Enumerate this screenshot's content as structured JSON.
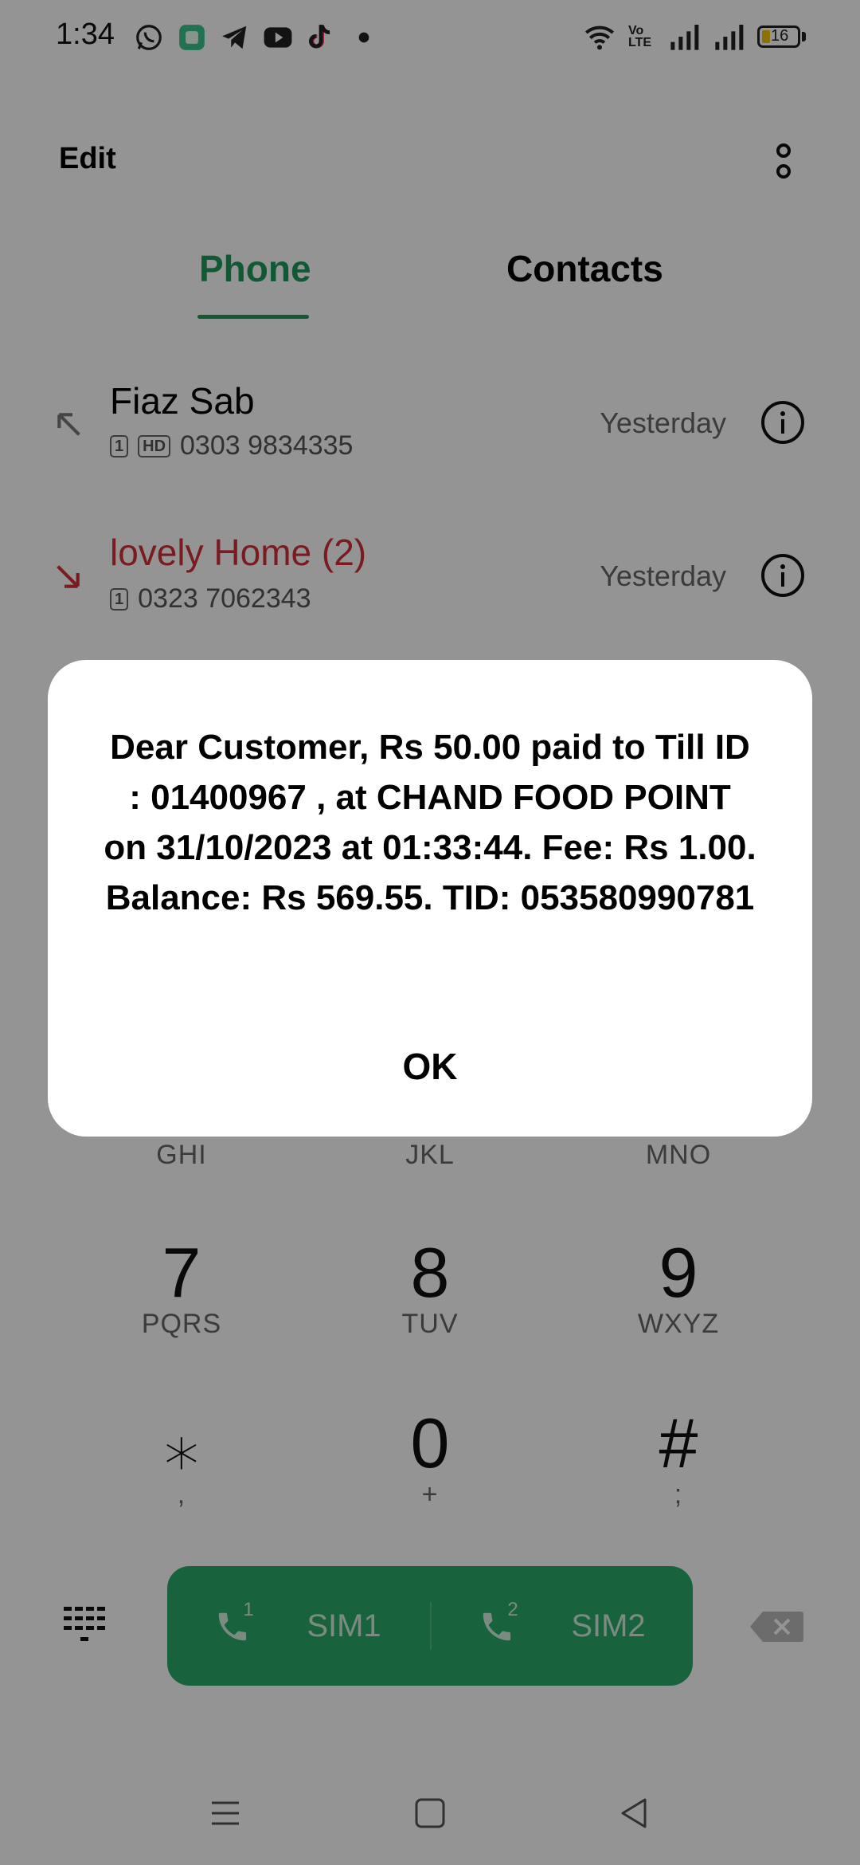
{
  "status_bar": {
    "time": "1:34",
    "battery_level": "16",
    "notification_icons": [
      "whatsapp-icon",
      "app-icon",
      "telegram-icon",
      "youtube-icon",
      "tiktok-icon",
      "dot-icon"
    ],
    "network_label": "Vo LTE"
  },
  "header": {
    "edit_label": "Edit"
  },
  "tabs": [
    {
      "label": "Phone",
      "active": true
    },
    {
      "label": "Contacts",
      "active": false
    }
  ],
  "call_log": [
    {
      "name": "Fiaz Sab",
      "sim_chip": "1",
      "hd_chip": "HD",
      "number": "0303 9834335",
      "time": "Yesterday",
      "direction": "outgoing",
      "name_color": "#111111"
    },
    {
      "name": "lovely Home (2)",
      "sim_chip": "1",
      "number": "0323 7062343",
      "time": "Yesterday",
      "direction": "missed",
      "name_color": "#d2303c"
    }
  ],
  "dialpad": {
    "rows": [
      [
        {
          "letters": "GHI"
        },
        {
          "letters": "JKL"
        },
        {
          "letters": "MNO"
        }
      ],
      [
        {
          "digit": "7",
          "letters": "PQRS"
        },
        {
          "digit": "8",
          "letters": "TUV"
        },
        {
          "digit": "9",
          "letters": "WXYZ"
        }
      ],
      [
        {
          "digit": "⁎",
          "letters": ","
        },
        {
          "digit": "0",
          "letters": "+"
        },
        {
          "digit": "#",
          "letters": ";"
        }
      ]
    ]
  },
  "call_buttons": {
    "sim1": {
      "badge": "1",
      "label": "SIM1"
    },
    "sim2": {
      "badge": "2",
      "label": "SIM2"
    },
    "accent": "#2aa96b"
  },
  "dialog": {
    "message": "Dear Customer, Rs 50.00 paid to Till ID : 01400967 , at CHAND FOOD POINT on 31/10/2023 at 01:33:44. Fee: Rs 1.00. Balance: Rs 569.55. TID: 053580990781",
    "ok_label": "OK"
  },
  "colors": {
    "accent_green": "#1e9a5a",
    "missed_red": "#d2303c"
  }
}
